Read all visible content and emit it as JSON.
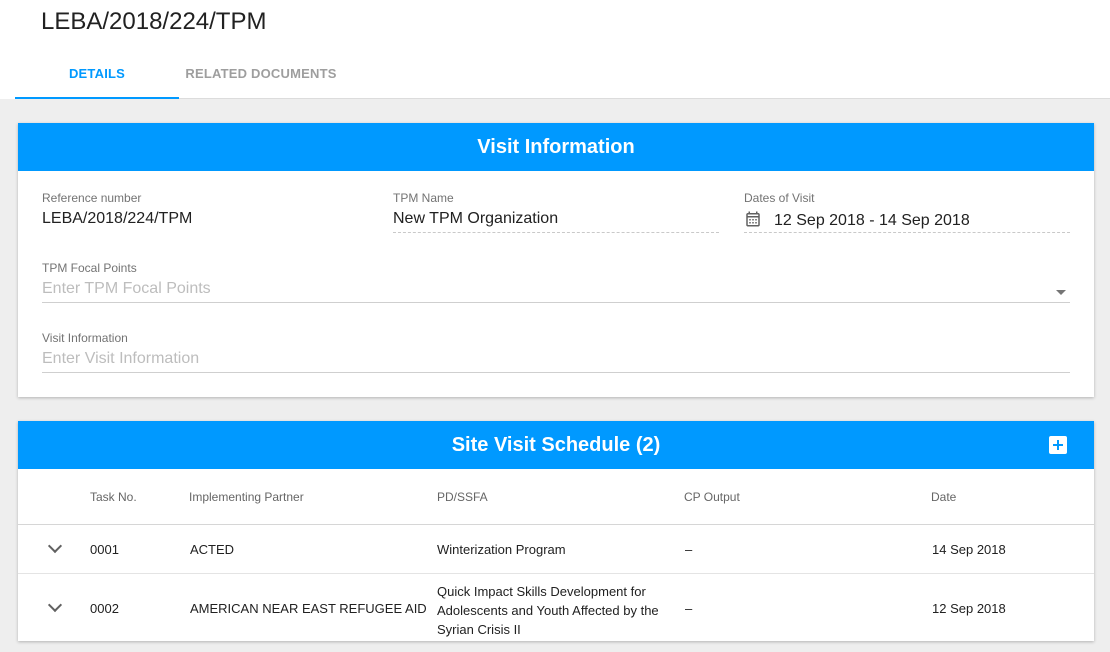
{
  "page": {
    "title": "LEBA/2018/224/TPM"
  },
  "tabs": [
    {
      "label": "DETAILS",
      "active": true
    },
    {
      "label": "RELATED DOCUMENTS",
      "active": false
    }
  ],
  "visit_info": {
    "header": "Visit Information",
    "reference_number": {
      "label": "Reference number",
      "value": "LEBA/2018/224/TPM"
    },
    "tpm_name": {
      "label": "TPM Name",
      "value": "New TPM Organization"
    },
    "dates": {
      "label": "Dates of Visit",
      "value": "12 Sep 2018 - 14 Sep 2018",
      "icon": "calendar-icon"
    },
    "focal_points": {
      "label": "TPM Focal Points",
      "placeholder": "Enter TPM Focal Points"
    },
    "visit_information": {
      "label": "Visit Information",
      "placeholder": "Enter Visit Information"
    }
  },
  "schedule": {
    "header": "Site Visit Schedule (2)",
    "add_icon": "add-box-icon",
    "columns": [
      "Task No.",
      "Implementing Partner",
      "PD/SSFA",
      "CP Output",
      "Date"
    ],
    "rows": [
      {
        "task_no": "0001",
        "partner": "ACTED",
        "pd_line1": "Winterization Program",
        "pd_line2": "",
        "pd_line3": "",
        "cp_output": "–",
        "date": "14 Sep 2018"
      },
      {
        "task_no": "0002",
        "partner": "AMERICAN NEAR EAST REFUGEE AID",
        "pd_line1": "Quick Impact Skills Development for",
        "pd_line2": "Adolescents and Youth Affected by the",
        "pd_line3": "Syrian Crisis II",
        "cp_output": "–",
        "date": "12 Sep 2018"
      }
    ]
  },
  "colors": {
    "accent": "#0099ff",
    "background": "#eeeeee"
  }
}
